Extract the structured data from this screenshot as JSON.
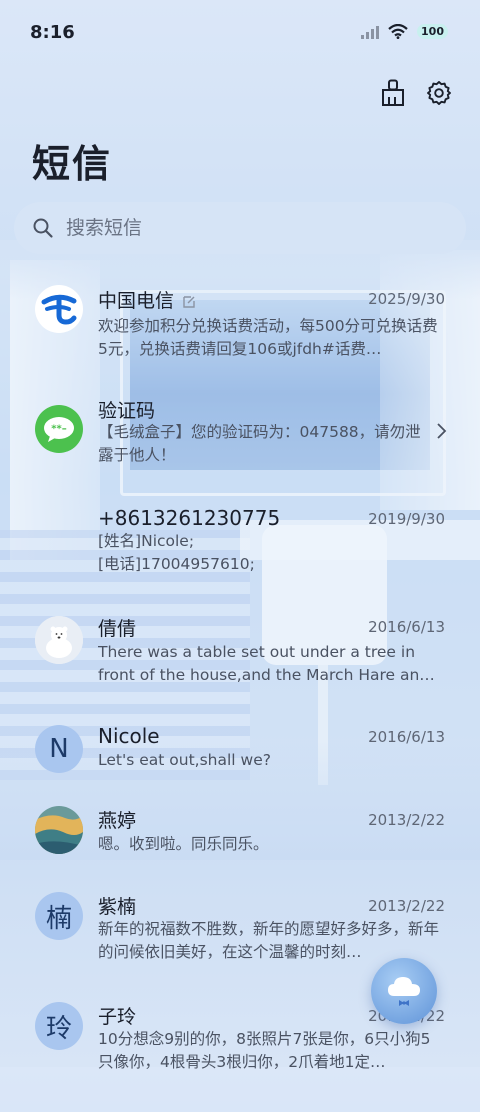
{
  "status": {
    "time": "8:16",
    "battery": "100"
  },
  "title": "短信",
  "search": {
    "placeholder": "搜索短信"
  },
  "messages": [
    {
      "name": "中国电信",
      "date": "2025/9/30",
      "preview": "欢迎参加积分兑换话费活动，每500分可兑换话费5元，兑换话费请回复106或jfdh#话费…",
      "avatar": "china-telecom-logo"
    },
    {
      "name": "验证码",
      "date": "",
      "preview": "【毛绒盒子】您的验证码为：047588，请勿泄露于他人！",
      "avatar": "message-bubble-logo"
    },
    {
      "name": "+8613261230775",
      "date": "2019/9/30",
      "preview": "[姓名]Nicole;\n[电话]17004957610;",
      "avatar": ""
    },
    {
      "name": "倩倩",
      "date": "2016/6/13",
      "preview": "There was a table set out under a tree in front of the house,and the March Hare an…",
      "avatar": "polar-bear-photo"
    },
    {
      "name": "Nicole",
      "date": "2016/6/13",
      "preview": "Let's eat out,shall we?",
      "avatar": "N"
    },
    {
      "name": "燕婷",
      "date": "2013/2/22",
      "preview": "嗯。收到啦。同乐同乐。",
      "avatar": "landscape-photo"
    },
    {
      "name": "紫楠",
      "date": "2013/2/22",
      "preview": "新年的祝福数不胜数，新年的愿望好多好多，新年的问候依旧美好，在这个温馨的时刻…",
      "avatar": "楠"
    },
    {
      "name": "子玲",
      "date": "2013/2/22",
      "preview": "10分想念9别的你，8张照片7张是你，6只小狗5只像你，4根骨头3根归你，2爪着地1定…",
      "avatar": "玲"
    }
  ],
  "colors": {
    "accent": "#4f86cf",
    "telecom": "#1769d6",
    "green": "#4cc14e"
  }
}
